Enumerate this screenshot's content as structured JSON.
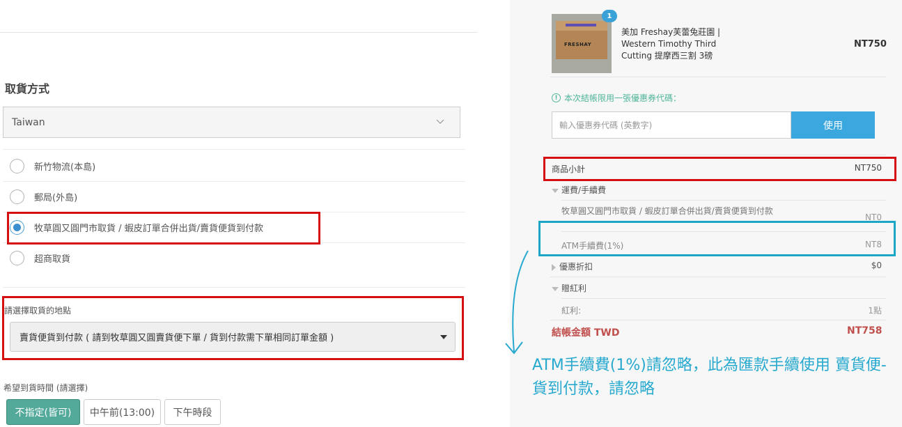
{
  "left": {
    "section_title": "取貨方式",
    "country": "Taiwan",
    "shipping_options": [
      {
        "label": "新竹物流(本島)",
        "selected": false
      },
      {
        "label": "郵局(外島)",
        "selected": false
      },
      {
        "label": "牧草圓又圓門市取貨 / 蝦皮訂單合併出貨/賣貨便貨到付款",
        "selected": true
      },
      {
        "label": "超商取貨",
        "selected": false
      }
    ],
    "location_label": "請選擇取貨的地點",
    "location_value": "賣貨便貨到付款 ( 請到牧草圓又圓賣貨便下單 / 貨到付款需下單相同訂單金額 )",
    "time_label": "希望到貨時間 (請選擇)",
    "time_options": [
      "不指定(皆可)",
      "中午前(13:00)",
      "下午時段"
    ],
    "time_selected": "不指定(皆可)"
  },
  "right": {
    "item": {
      "qty": "1",
      "name": "美加 Freshay芙蕾兔莊園 | Western Timothy Third Cutting 提摩西三割 3磅",
      "image_logo": "FRESHAY",
      "price": "NT750"
    },
    "coupon": {
      "note": "本次結帳限用一張優惠券代碼：",
      "placeholder": "輸入優惠券代碼 (英數字)",
      "button": "使用"
    },
    "summary": {
      "subtotal_label": "商品小計",
      "subtotal_value": "NT750",
      "shipping_header": "運費/手續費",
      "shipping_line_label": "牧草圓又圓門市取貨 / 蝦皮訂單合併出貨/賣貨便貨到付款",
      "shipping_line_value": "NT0",
      "atm_label": "ATM手續費(1%)",
      "atm_value": "NT8",
      "discount_label": "優惠折扣",
      "discount_value": "$0",
      "bonus_header": "贈紅利",
      "bonus_label": "紅利:",
      "bonus_value": "1點",
      "total_label": "結帳金額 TWD",
      "total_value": "NT758"
    },
    "annotation": "ATM手續費(1%)請忽略，此為匯款手續使用 賣貨便-貨到付款，請忽略"
  },
  "colors": {
    "highlight_red": "#d50f0f",
    "highlight_blue": "#1ea6c7",
    "primary_button": "#3aa7df",
    "active_time_button": "#53a99a",
    "total_text": "#c0504d",
    "annotation_text": "#27a9cf"
  }
}
